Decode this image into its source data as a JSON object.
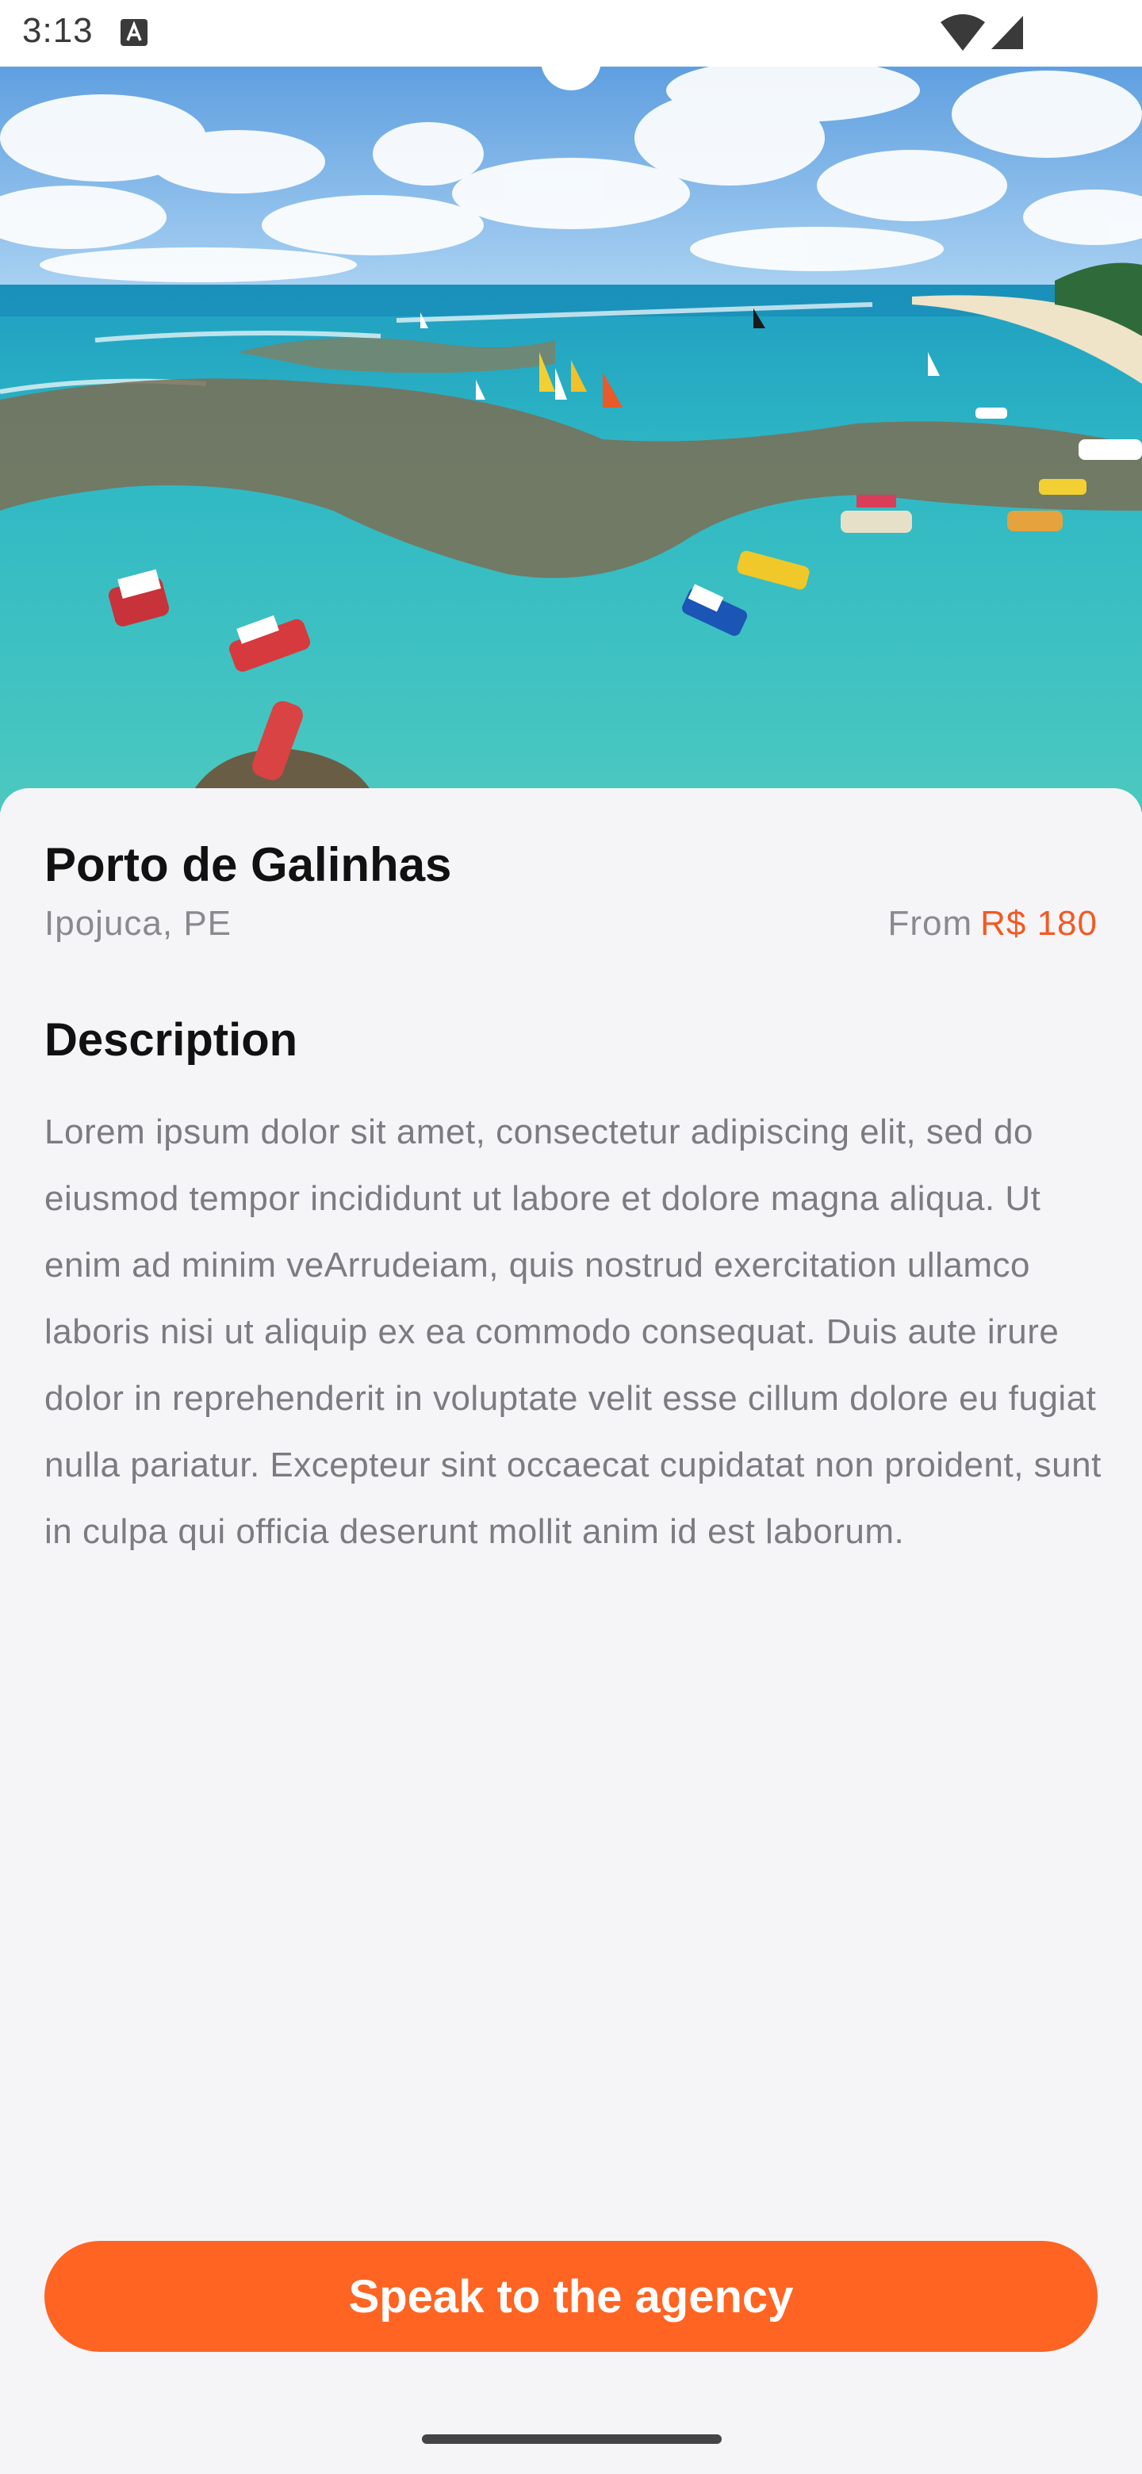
{
  "status_bar": {
    "time": "3:13",
    "icons": [
      "text-a-icon",
      "wifi-icon",
      "signal-icon"
    ]
  },
  "hero": {
    "image": "beach-aerial-image"
  },
  "place": {
    "name": "Porto de Galinhas",
    "location": "Ipojuca, PE",
    "price_prefix": "From",
    "price_value": "R$ 180"
  },
  "description": {
    "heading": "Description",
    "body": "Lorem ipsum dolor sit amet, consectetur adipiscing elit, sed do eiusmod tempor incididunt ut labore et dolore magna aliqua. Ut enim ad minim veArrudeiam, quis nostrud exercitation ullamco laboris nisi ut aliquip ex ea commodo consequat. Duis aute irure dolor in reprehenderit in voluptate velit esse cillum dolore eu fugiat nulla pariatur. Excepteur sint occaecat cupidatat non proident, sunt in culpa qui officia deserunt mollit anim id est laborum."
  },
  "cta": {
    "label": "Speak to the agency"
  },
  "colors": {
    "accent": "#ff6422",
    "price": "#f25a22",
    "background": "#f5f5f8",
    "title": "#111111",
    "muted": "#7c7c80"
  }
}
